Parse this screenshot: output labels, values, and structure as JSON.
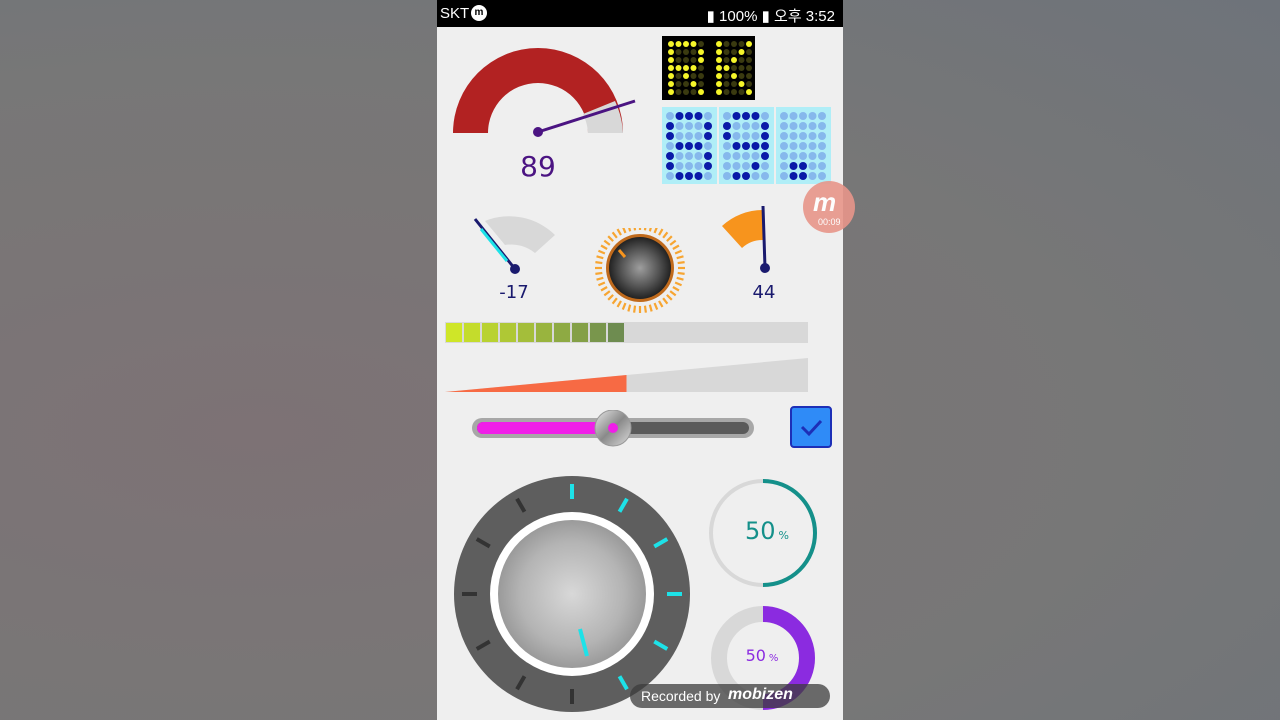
{
  "status_bar": {
    "carrier": "SKT",
    "battery": "100%",
    "time": "오후 3:52"
  },
  "gauge_main": {
    "value": "89"
  },
  "led_letters": {
    "text": "RK"
  },
  "led_digits": {
    "text": "89."
  },
  "small_gauge_left": {
    "value": "-17"
  },
  "small_gauge_right": {
    "value": "44"
  },
  "level_bar": {
    "fill_fraction": 0.5
  },
  "wedge_bar": {
    "fill_fraction": 0.5
  },
  "slider": {
    "fraction": 0.5
  },
  "checkbox": {
    "checked": true
  },
  "progress_top": {
    "value": "50",
    "unit": "%",
    "fraction": 0.5
  },
  "progress_bottom": {
    "value": "50",
    "unit": "%",
    "fraction": 0.5
  },
  "overlay": {
    "timer": "00:09"
  },
  "watermark": {
    "label": "Recorded by",
    "brand": "mobizen"
  },
  "colors": {
    "gauge_red": "#b22222",
    "needle_purple": "#4b1482",
    "led_yellow": "#f5f52a",
    "led_blue": "#0a1aa8",
    "accent_orange": "#f7941d",
    "cyan": "#1de2e8",
    "magenta": "#f01ee8",
    "teal": "#14908a",
    "violet": "#8b2be0"
  }
}
